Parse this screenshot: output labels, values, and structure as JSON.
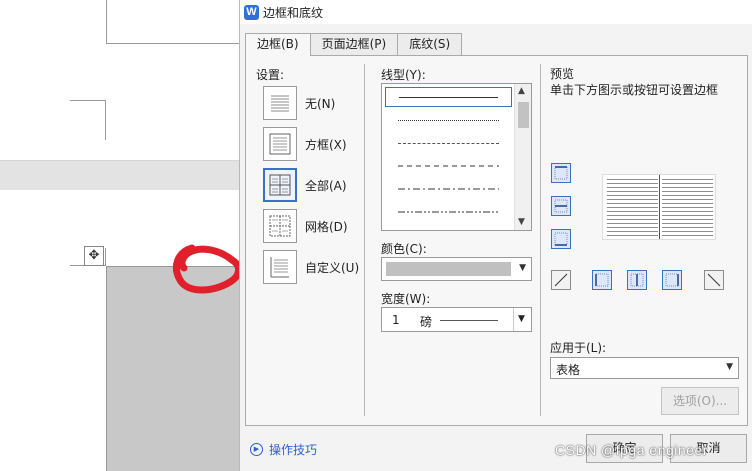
{
  "dialog": {
    "title": "边框和底纹",
    "tabs": [
      "边框(B)",
      "页面边框(P)",
      "底纹(S)"
    ]
  },
  "settings": {
    "label": "设置:",
    "items": [
      {
        "label": "无(N)",
        "icon": "none-border-icon"
      },
      {
        "label": "方框(X)",
        "icon": "box-border-icon"
      },
      {
        "label": "全部(A)",
        "icon": "all-borders-icon",
        "selected": true
      },
      {
        "label": "网格(D)",
        "icon": "grid-border-icon"
      },
      {
        "label": "自定义(U)",
        "icon": "custom-border-icon"
      }
    ]
  },
  "line_style": {
    "label": "线型(Y):",
    "selected_index": 0
  },
  "color": {
    "label": "颜色(C):",
    "value": "#c0c0c0"
  },
  "width": {
    "label": "宽度(W):",
    "value": "1",
    "unit": "磅"
  },
  "preview": {
    "label": "预览",
    "hint": "单击下方图示或按钮可设置边框"
  },
  "apply_to": {
    "label": "应用于(L):",
    "value": "表格"
  },
  "buttons": {
    "options": "选项(O)...",
    "ok": "确定",
    "cancel": "取消"
  },
  "tips": {
    "label": "操作技巧"
  },
  "watermark": "CSDN @fpga engineer",
  "colors": {
    "accent": "#3b70c4",
    "link": "#2a62c9",
    "annotation": "#e0202a"
  }
}
